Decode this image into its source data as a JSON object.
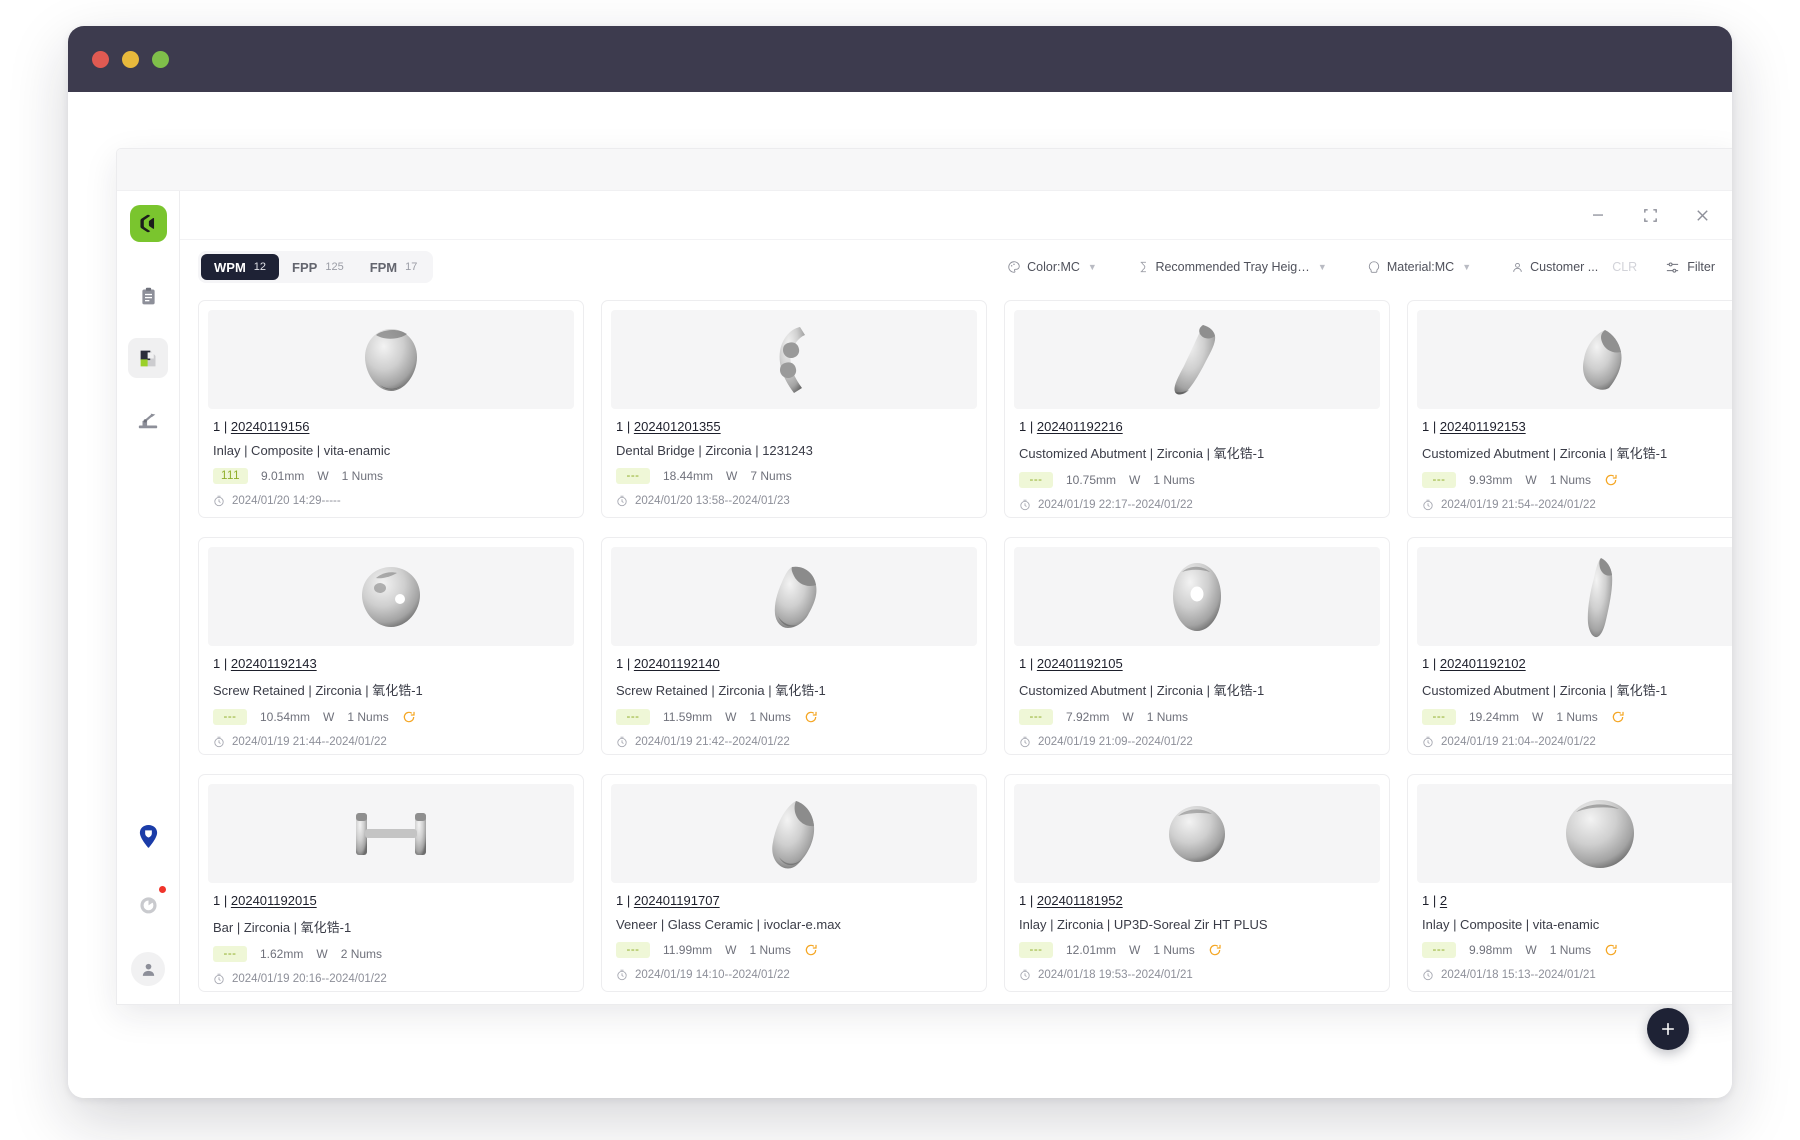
{
  "window": {
    "traffic_lights": [
      "close",
      "minimize",
      "maximize"
    ],
    "colors": {
      "titlebar": "#3D3B4E",
      "red": "#E05A52",
      "yellow": "#E8B93C",
      "green": "#7FBF4A",
      "accent_green": "#7AC52E",
      "dark": "#1E2235"
    },
    "controls": {
      "minimize": "minimize-icon",
      "restore": "restore-icon",
      "close": "close-icon"
    }
  },
  "sidebar": {
    "logo": "app-logo",
    "items": [
      {
        "name": "clipboard",
        "icon": "clipboard-icon",
        "active": false
      },
      {
        "name": "layers",
        "icon": "layers-icon",
        "active": true
      },
      {
        "name": "machine",
        "icon": "robot-arm-icon",
        "active": false
      }
    ],
    "bottom_items": [
      {
        "name": "shield-pin",
        "icon": "shield-pin-icon"
      },
      {
        "name": "notifications",
        "icon": "notification-icon",
        "has_badge": true
      },
      {
        "name": "account",
        "icon": "user-icon"
      }
    ]
  },
  "toolbar": {
    "tabs": [
      {
        "label": "WPM",
        "count": "12",
        "active": true
      },
      {
        "label": "FPP",
        "count": "125",
        "active": false
      },
      {
        "label": "FPM",
        "count": "17",
        "active": false
      }
    ],
    "filters": [
      {
        "label": "Color:MC",
        "icon": "palette-icon",
        "caret": true
      },
      {
        "label": "Recommended Tray Heigh...",
        "icon": "height-icon",
        "caret": true
      },
      {
        "label": "Material:MC",
        "icon": "material-icon",
        "caret": true
      },
      {
        "label": "Customer ...",
        "icon": "user-icon",
        "caret": false
      }
    ],
    "clear_label": "CLR",
    "filter_label": "Filter",
    "filter_icon": "filter-icon"
  },
  "fab": {
    "label": "+",
    "name": "add-button"
  },
  "cards": [
    {
      "index": "1",
      "id": "20240119156",
      "title": "Inlay | Composite | vita-enamic",
      "badge": "111",
      "height": "9.01mm",
      "flag": "W",
      "nums": "1 Nums",
      "refresh": false,
      "time": "2024/01/20 14:29-----",
      "shape": "round-inlay"
    },
    {
      "index": "1",
      "id": "202401201355",
      "title": "Dental Bridge | Zirconia | 1231243",
      "badge": "---",
      "height": "18.44mm",
      "flag": "W",
      "nums": "7 Nums",
      "refresh": false,
      "time": "2024/01/20 13:58--2024/01/23",
      "shape": "bridge"
    },
    {
      "index": "1",
      "id": "202401192216",
      "title": "Customized Abutment | Zirconia | 氧化锆-1",
      "badge": "---",
      "height": "10.75mm",
      "flag": "W",
      "nums": "1 Nums",
      "refresh": false,
      "time": "2024/01/19 22:17--2024/01/22",
      "shape": "abutment-tilt"
    },
    {
      "index": "1",
      "id": "202401192153",
      "title": "Customized Abutment | Zirconia | 氧化锆-1",
      "badge": "---",
      "height": "9.93mm",
      "flag": "W",
      "nums": "1 Nums",
      "refresh": true,
      "time": "2024/01/19 21:54--2024/01/22",
      "shape": "wedge"
    },
    {
      "index": "1",
      "id": "202401192143",
      "title": "Screw Retained | Zirconia | 氧化锆-1",
      "badge": "---",
      "height": "10.54mm",
      "flag": "W",
      "nums": "1 Nums",
      "refresh": true,
      "time": "2024/01/19 21:44--2024/01/22",
      "shape": "screw-retained"
    },
    {
      "index": "1",
      "id": "202401192140",
      "title": "Screw Retained | Zirconia | 氧化锆-1",
      "badge": "---",
      "height": "11.59mm",
      "flag": "W",
      "nums": "1 Nums",
      "refresh": true,
      "time": "2024/01/19 21:42--2024/01/22",
      "shape": "molar-chunk"
    },
    {
      "index": "1",
      "id": "202401192105",
      "title": "Customized Abutment | Zirconia | 氧化锆-1",
      "badge": "---",
      "height": "7.92mm",
      "flag": "W",
      "nums": "1 Nums",
      "refresh": false,
      "time": "2024/01/19 21:09--2024/01/22",
      "shape": "ring-abutment"
    },
    {
      "index": "1",
      "id": "202401192102",
      "title": "Customized Abutment | Zirconia | 氧化锆-1",
      "badge": "---",
      "height": "19.24mm",
      "flag": "W",
      "nums": "1 Nums",
      "refresh": true,
      "time": "2024/01/19 21:04--2024/01/22",
      "shape": "tall-sliver"
    },
    {
      "index": "1",
      "id": "202401192015",
      "title": "Bar | Zirconia | 氧化锆-1",
      "badge": "---",
      "height": "1.62mm",
      "flag": "W",
      "nums": "2 Nums",
      "refresh": false,
      "time": "2024/01/19 20:16--2024/01/22",
      "shape": "bar"
    },
    {
      "index": "1",
      "id": "202401191707",
      "title": "Veneer | Glass Ceramic | ivoclar-e.max",
      "badge": "---",
      "height": "11.99mm",
      "flag": "W",
      "nums": "1 Nums",
      "refresh": true,
      "time": "2024/01/19 14:10--2024/01/22",
      "shape": "veneer"
    },
    {
      "index": "1",
      "id": "202401181952",
      "title": "Inlay | Zirconia | UP3D-Soreal Zir HT PLUS",
      "badge": "---",
      "height": "12.01mm",
      "flag": "W",
      "nums": "1 Nums",
      "refresh": true,
      "time": "2024/01/18 19:53--2024/01/21",
      "shape": "sphere"
    },
    {
      "index": "1",
      "id": "2",
      "title": "Inlay | Composite | vita-enamic",
      "badge": "---",
      "height": "9.98mm",
      "flag": "W",
      "nums": "1 Nums",
      "refresh": true,
      "time": "2024/01/18 15:13--2024/01/21",
      "shape": "big-sphere"
    }
  ]
}
